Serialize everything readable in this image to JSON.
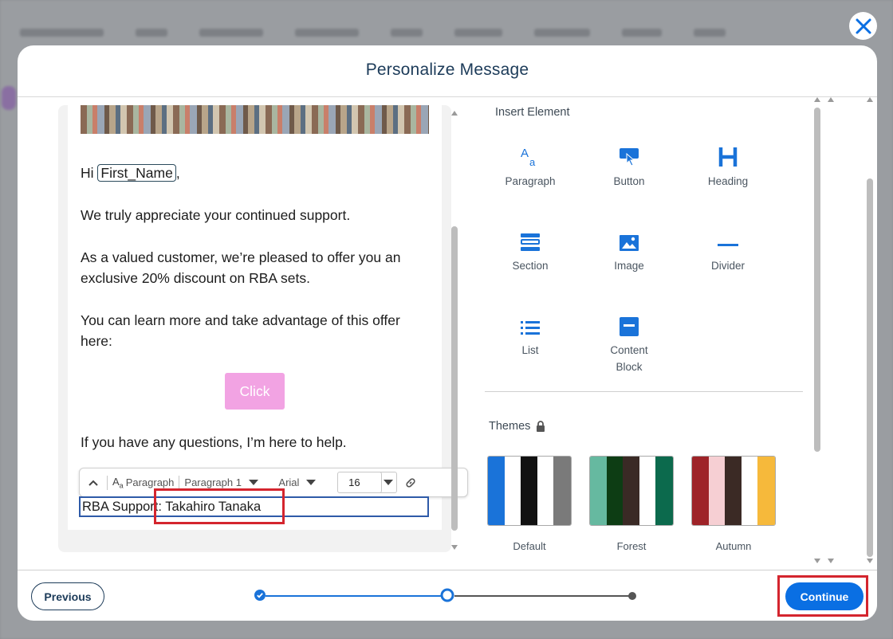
{
  "modal": {
    "title": "Personalize Message"
  },
  "email": {
    "greeting_prefix": "Hi",
    "greeting_token": "First_Name",
    "greeting_suffix": ",",
    "line1": "We truly appreciate your continued support.",
    "line2a": "As a valued customer, we’re pleased to offer you an",
    "line2b": "exclusive 20% discount on RBA sets.",
    "line3a": "You can learn more and take advantage of this offer",
    "line3b": "here:",
    "cta_label": "Click",
    "line4": "If you have any questions, I’m here to help.",
    "signature": "RBA Support: Takahiro Tanaka"
  },
  "toolbar": {
    "style_label": "Paragraph",
    "format_value": "Paragraph 1",
    "font_value": "Arial",
    "size_value": "16",
    "collapse_icon": "chevron-up-icon",
    "link_icon": "link-icon"
  },
  "insert_panel": {
    "title": "Insert Element",
    "elements": [
      {
        "label": "Paragraph",
        "icon": "paragraph-icon"
      },
      {
        "label": "Button",
        "icon": "button-tap-icon"
      },
      {
        "label": "Heading",
        "icon": "heading-icon"
      },
      {
        "label": "Section",
        "icon": "section-icon"
      },
      {
        "label": "Image",
        "icon": "image-icon"
      },
      {
        "label": "Divider",
        "icon": "divider-icon"
      },
      {
        "label": "List",
        "icon": "list-icon"
      },
      {
        "label": "Content",
        "label2": "Block",
        "icon": "content-block-icon"
      }
    ]
  },
  "themes": {
    "title": "Themes",
    "lock_icon": "lock-icon",
    "items": [
      {
        "label": "Default",
        "colors": [
          "#1a73d9",
          "#ffffff",
          "#111111",
          "#ffffff",
          "#7a7a7a"
        ]
      },
      {
        "label": "Forest",
        "colors": [
          "#66b9a0",
          "#0d3d14",
          "#3a2a25",
          "#ffffff",
          "#0c6a4d"
        ]
      },
      {
        "label": "Autumn",
        "colors": [
          "#9e2328",
          "#f6cfd3",
          "#3b2a25",
          "#ffffff",
          "#f6b93b"
        ]
      }
    ]
  },
  "footer": {
    "previous_label": "Previous",
    "continue_label": "Continue",
    "steps": [
      "complete",
      "current",
      "upcoming"
    ]
  },
  "colors": {
    "accent": "#0a6fe3",
    "title": "#1c3b59",
    "cta": "#f2a3e3",
    "highlight": "#d4252e"
  }
}
